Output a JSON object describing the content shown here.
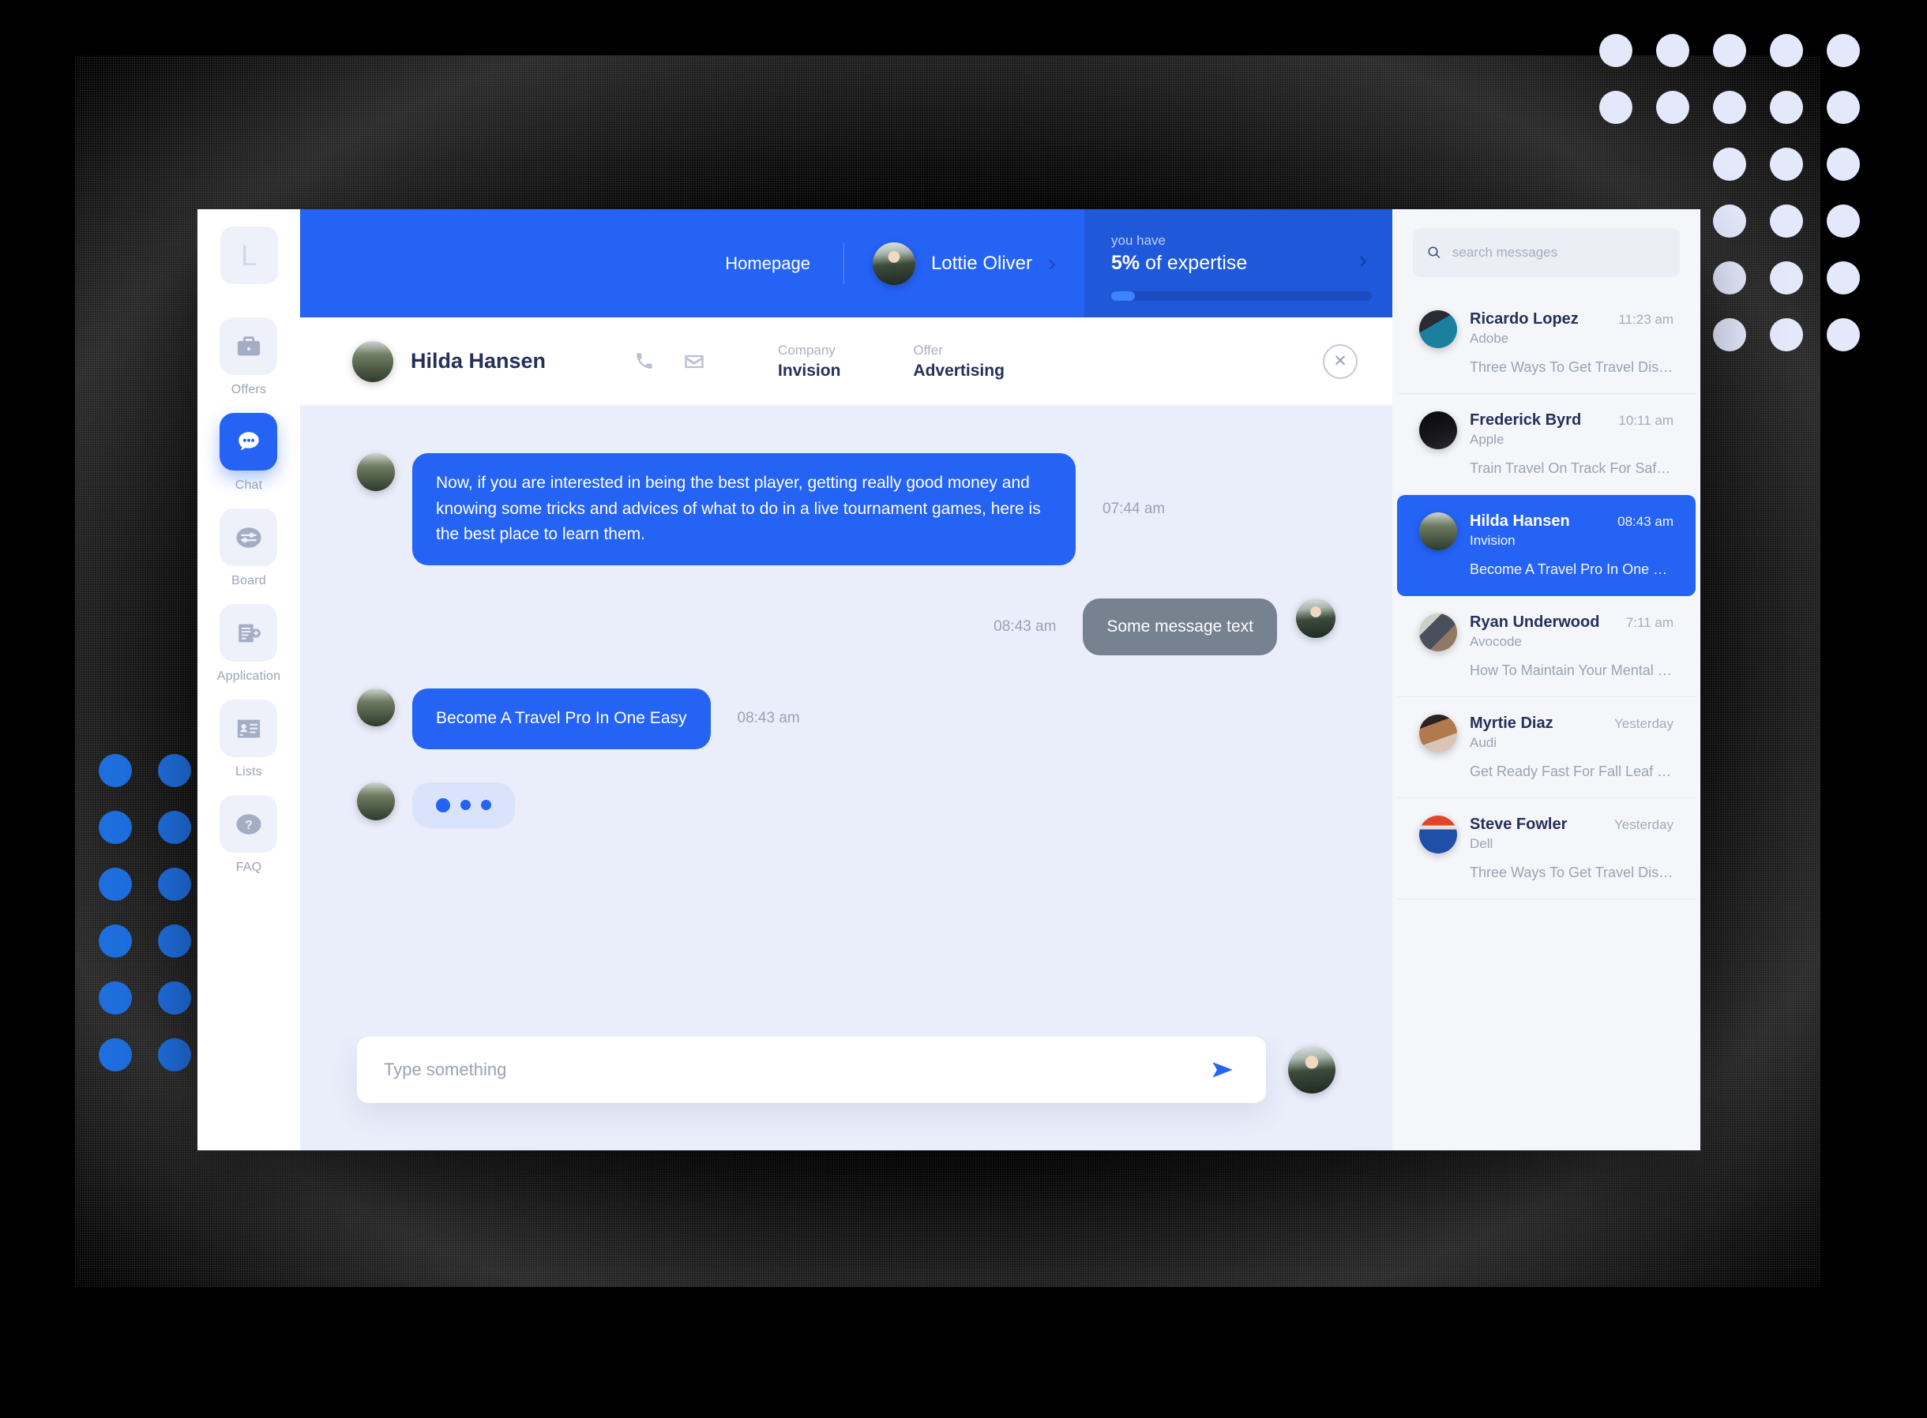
{
  "topbar": {
    "homepage_label": "Homepage",
    "user_name": "Lottie Oliver",
    "chevron": "›"
  },
  "expertise": {
    "pretitle": "you have",
    "percent": "5%",
    "suffix": " of expertise",
    "progress_percent": 5,
    "chevron": "›"
  },
  "rail": {
    "logo_letter": "L",
    "items": [
      {
        "label": "Offers",
        "icon": "briefcase-icon",
        "active": false
      },
      {
        "label": "Chat",
        "icon": "chat-bubble-icon",
        "active": true
      },
      {
        "label": "Board",
        "icon": "sliders-icon",
        "active": false
      },
      {
        "label": "Application",
        "icon": "document-plus-icon",
        "active": false
      },
      {
        "label": "Lists",
        "icon": "contact-card-icon",
        "active": false
      },
      {
        "label": "FAQ",
        "icon": "question-mark-icon",
        "active": false
      }
    ]
  },
  "contact": {
    "name": "Hilda Hansen",
    "phone_icon": "phone-icon",
    "mail_icon": "envelope-icon",
    "company_label": "Company",
    "company_value": "Invision",
    "offer_label": "Offer",
    "offer_value": "Advertising",
    "close_glyph": "✕"
  },
  "messages": [
    {
      "direction": "in",
      "text": "Now, if you are interested in being the best player, getting really good money and knowing some tricks and advices of what to do in a live tournament games, here is the best place to learn them.",
      "time": "07:44 am",
      "style": "blue"
    },
    {
      "direction": "out",
      "text": "Some message text",
      "time": "08:43 am",
      "style": "grey"
    },
    {
      "direction": "in",
      "text": "Become A Travel Pro In One Easy",
      "time": "08:43 am",
      "style": "blue"
    },
    {
      "direction": "in",
      "text": "",
      "time": "",
      "style": "typing"
    }
  ],
  "composer": {
    "placeholder": "Type something",
    "value": "",
    "send_icon": "send-arrow-icon"
  },
  "search": {
    "placeholder": "search messages",
    "value": "",
    "icon": "search-icon"
  },
  "conversations": [
    {
      "name": "Ricardo Lopez",
      "company": "Adobe",
      "time": "11:23 am",
      "preview": "Three Ways To Get Travel Disco…",
      "active": false,
      "avatar": "av-ricardo"
    },
    {
      "name": "Frederick Byrd",
      "company": "Apple",
      "time": "10:11 am",
      "preview": "Train Travel On Track For Safety",
      "active": false,
      "avatar": "av-frederick"
    },
    {
      "name": "Hilda Hansen",
      "company": "Invision",
      "time": "08:43 am",
      "preview": "Become A Travel Pro In One Eas..",
      "active": true,
      "avatar": "av-hilda"
    },
    {
      "name": "Ryan Underwood",
      "company": "Avocode",
      "time": "7:11 am",
      "preview": "How To Maintain Your Mental Heal..",
      "active": false,
      "avatar": "av-ryan"
    },
    {
      "name": "Myrtie Diaz",
      "company": "Audi",
      "time": "Yesterday",
      "preview": "Get Ready Fast For Fall Leaf Viewi…",
      "active": false,
      "avatar": "av-myrtie"
    },
    {
      "name": "Steve Fowler",
      "company": "Dell",
      "time": "Yesterday",
      "preview": "Three Ways To Get Travel Disco…",
      "active": false,
      "avatar": "av-steve"
    }
  ],
  "colors": {
    "accent": "#2563f5",
    "accent_dark": "#1f58d8",
    "chat_bg": "#eaeefa",
    "panel_bg": "#f5f6fa",
    "grey_bubble": "#76828f",
    "dot_light": "#e3e8fb",
    "dot_blue": "#1f6ede"
  }
}
